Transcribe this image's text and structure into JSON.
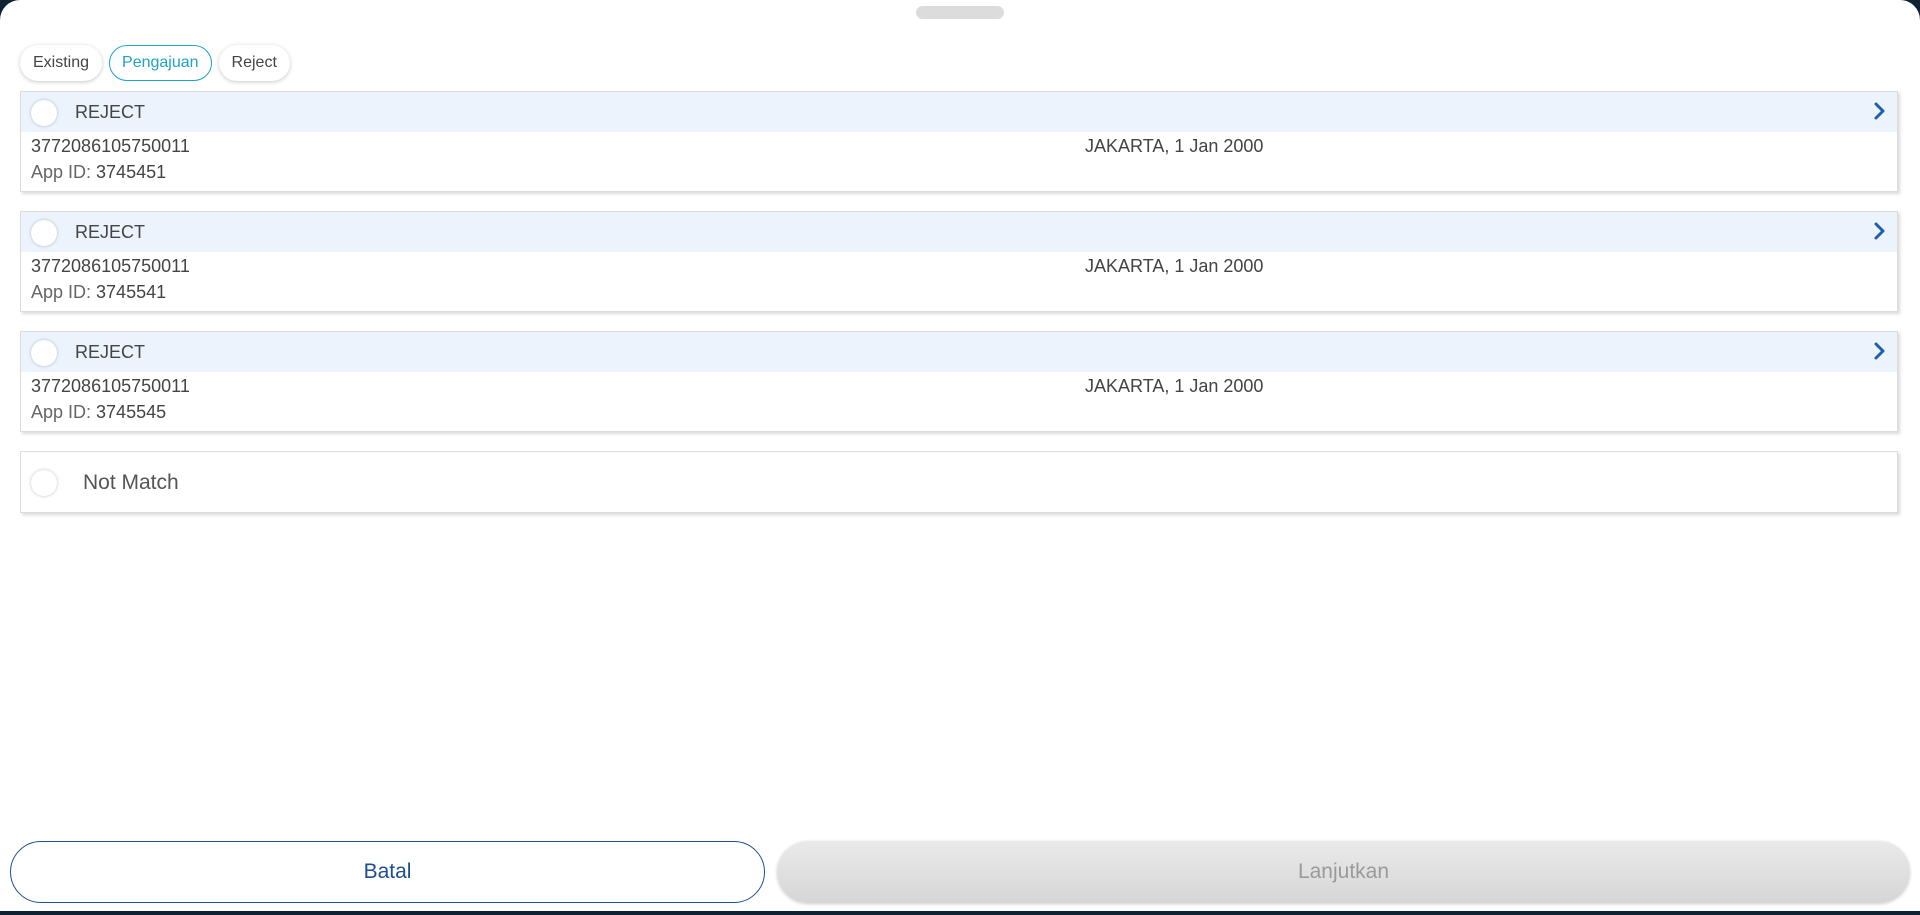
{
  "tabs": [
    {
      "label": "Existing",
      "active": false
    },
    {
      "label": "Pengajuan",
      "active": true
    },
    {
      "label": "Reject",
      "active": false
    }
  ],
  "records": [
    {
      "status": "REJECT",
      "id_number": "3772086105750011",
      "birth": "JAKARTA, 1 Jan 2000",
      "app_id_label": "App ID: ",
      "app_id": "3745451"
    },
    {
      "status": "REJECT",
      "id_number": "3772086105750011",
      "birth": "JAKARTA, 1 Jan 2000",
      "app_id_label": "App ID: ",
      "app_id": "3745541"
    },
    {
      "status": "REJECT",
      "id_number": "3772086105750011",
      "birth": "JAKARTA, 1 Jan 2000",
      "app_id_label": "App ID: ",
      "app_id": "3745545"
    }
  ],
  "not_match": {
    "label": "Not Match"
  },
  "buttons": {
    "cancel": "Batal",
    "next": "Lanjutkan"
  },
  "colors": {
    "accent": "#1fa3c7",
    "primary": "#1d4e8f",
    "header_bg": "#edf3fd",
    "disabled_text": "#9a9a9a"
  }
}
